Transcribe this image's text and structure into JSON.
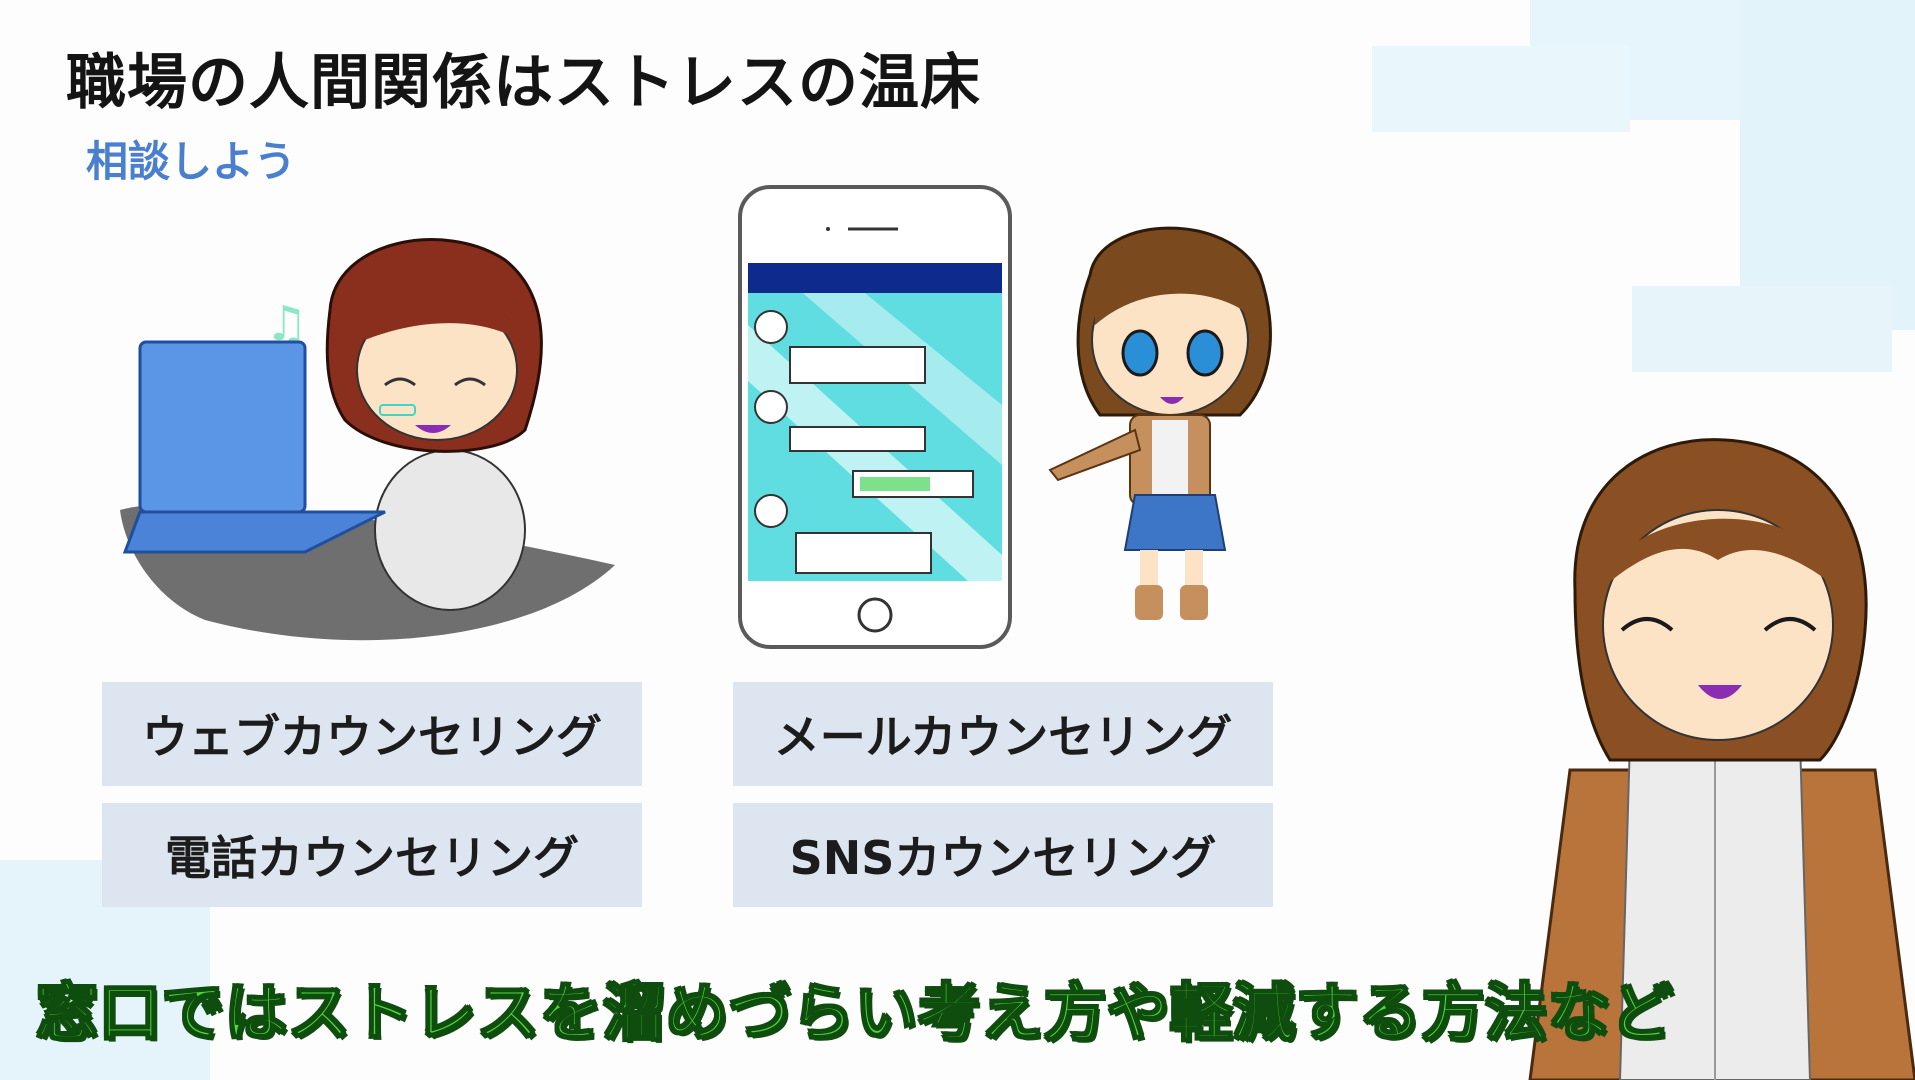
{
  "title": "職場の人間関係はストレスの温床",
  "subtitle": "相談しよう",
  "options": [
    "ウェブカウンセリング",
    "メールカウンセリング",
    "電話カウンセリング",
    "SNSカウンセリング"
  ],
  "caption": "窓口ではストレスを溜めづらい考え方や軽減する方法など",
  "colors": {
    "accent": "#4a7fd0",
    "box": "#dde6f0",
    "caption_fill": "#4fd63a",
    "caption_outline": "#0f4d0f",
    "phone_bar": "#0e2a8c",
    "phone_screen": "#5fdde0"
  },
  "icons": [
    "music-note-icon",
    "laptop-icon",
    "smartphone-icon",
    "chat-bubble-icon"
  ]
}
